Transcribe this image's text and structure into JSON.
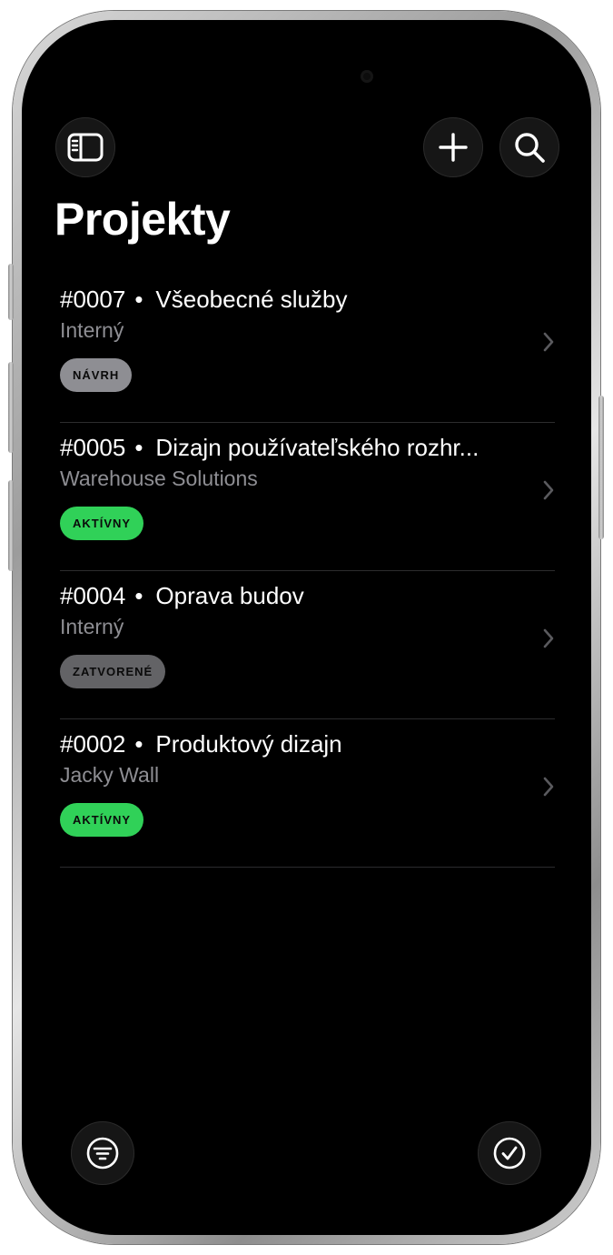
{
  "page": {
    "title": "Projekty"
  },
  "toolbar": {
    "sidebar_icon": "sidebar-icon",
    "add_icon": "plus-icon",
    "search_icon": "search-icon"
  },
  "projects": [
    {
      "number": "#0007",
      "separator": "•",
      "name": "Všeobecné služby",
      "client": "Interný",
      "status": "NÁVRH",
      "status_color": "#8e8e93"
    },
    {
      "number": "#0005",
      "separator": "•",
      "name": "Dizajn používateľského rozhr...",
      "client": "Warehouse Solutions",
      "status": "AKTÍVNY",
      "status_color": "#30d158"
    },
    {
      "number": "#0004",
      "separator": "•",
      "name": "Oprava budov",
      "client": "Interný",
      "status": "ZATVORENÉ",
      "status_color": "#636366"
    },
    {
      "number": "#0002",
      "separator": "•",
      "name": "Produktový dizajn",
      "client": "Jacky Wall",
      "status": "AKTÍVNY",
      "status_color": "#30d158"
    }
  ],
  "bottom": {
    "filter_icon": "filter-icon",
    "select_icon": "checkmark-circle-icon"
  },
  "colors": {
    "background": "#000000",
    "text_primary": "#ffffff",
    "text_secondary": "#8e8e93",
    "separator": "#2c2c2e",
    "button_bg": "#161616"
  }
}
